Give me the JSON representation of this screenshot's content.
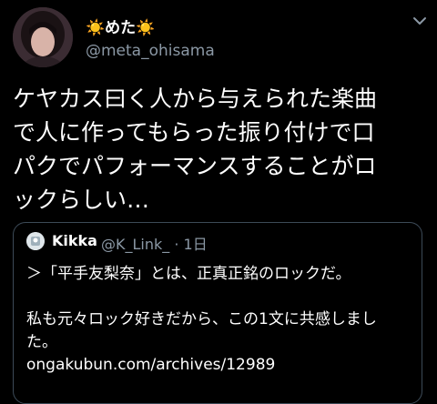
{
  "tweet": {
    "display_name": "☀️めた☀️",
    "handle": "@meta_ohisama",
    "body_lines": [
      "ケヤカス曰く人から与えられた楽曲",
      "で人に作ってもらった振り付けで口",
      "パクでパフォーマンスすることがロ",
      "ックらしい…"
    ]
  },
  "quoted": {
    "name": "Kikka",
    "handle_time": "@K_Link_ · 1日",
    "lines": [
      "＞「平手友梨奈」とは、正真正銘のロックだ。",
      "私も元々ロック好きだから、この1文に共感しまし",
      "た。",
      "ongakubun.com/archives/12989"
    ]
  },
  "icons": {
    "menu": "chevron-down-icon"
  }
}
